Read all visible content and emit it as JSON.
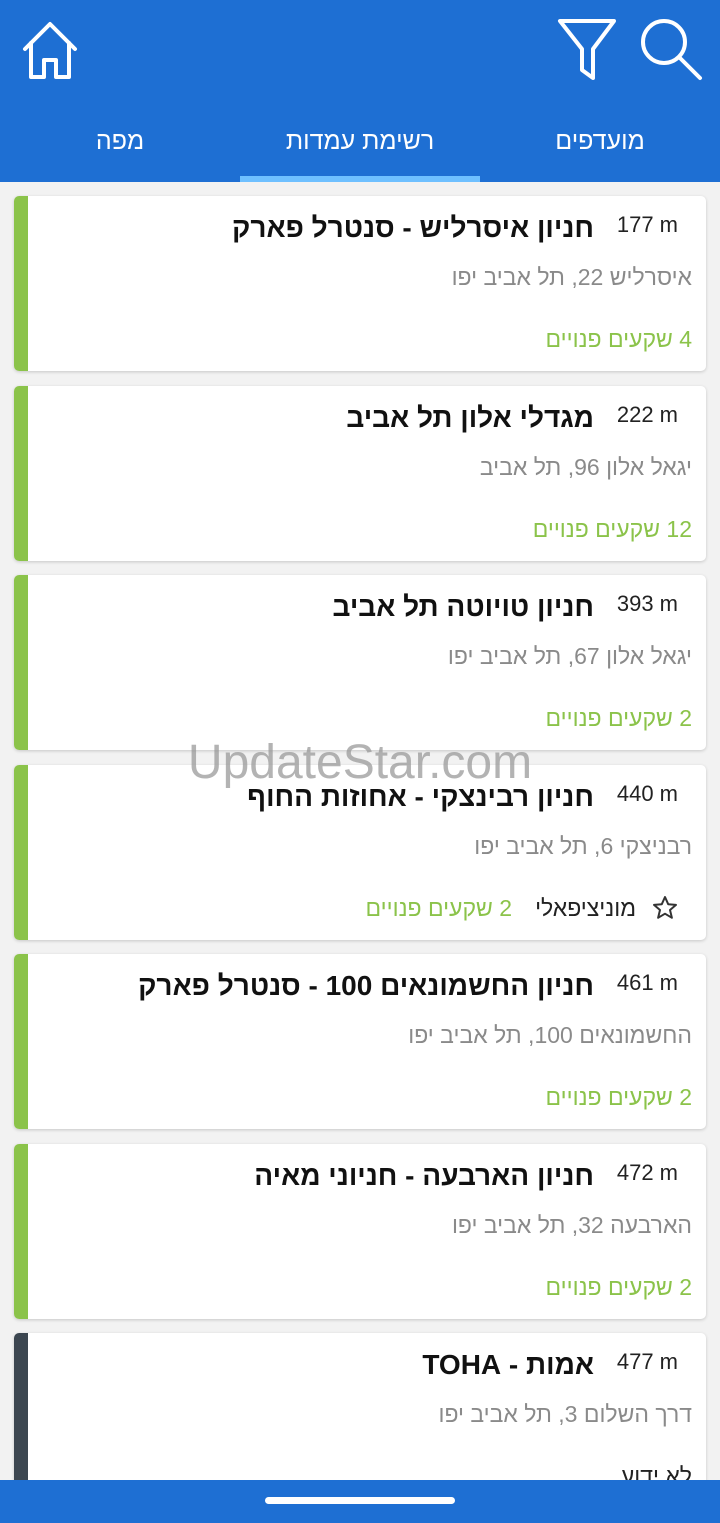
{
  "header": {
    "background": "#1e6fd3",
    "icons": {
      "home": "home-icon",
      "filter": "filter-icon",
      "search": "search-icon"
    },
    "tabs": [
      {
        "label": "מפה",
        "selected": false
      },
      {
        "label": "רשימת עמדות",
        "selected": true
      },
      {
        "label": "מועדפים",
        "selected": false
      }
    ]
  },
  "colors": {
    "available": "#8bc34a",
    "unknown": "#3c4650",
    "indicator": "#6fc0ff"
  },
  "parkings": [
    {
      "distance": "177 m",
      "name": "חניון איסרליש - סנטרל פארק",
      "address": "איסרליש 22, תל אביב יפו",
      "spots": "4 שקעים פנויים",
      "status_color": "#8bc34a"
    },
    {
      "distance": "222 m",
      "name": "מגדלי אלון תל אביב",
      "address": "יגאל אלון 96, תל אביב",
      "spots": "12 שקעים פנויים",
      "status_color": "#8bc34a"
    },
    {
      "distance": "393 m",
      "name": "חניון טויוטה תל אביב",
      "address": "יגאל אלון 67, תל אביב יפו",
      "spots": "2 שקעים פנויים",
      "status_color": "#8bc34a"
    },
    {
      "distance": "440 m",
      "name": "חניון רבינצקי - אחוזות החוף",
      "address": "רבניצקי 6, תל אביב יפו",
      "spots": "2 שקעים פנויים",
      "operator": "מוניציפאלי",
      "favorite_icon": "star-outline-icon",
      "status_color": "#8bc34a"
    },
    {
      "distance": "461 m",
      "name": "חניון החשמונאים 100 - סנטרל פארק",
      "address": "החשמונאים 100, תל אביב יפו",
      "spots": "2 שקעים פנויים",
      "status_color": "#8bc34a"
    },
    {
      "distance": "472 m",
      "name": "חניון הארבעה - חניוני מאיה",
      "address": "הארבעה 32, תל אביב יפו",
      "spots": "2 שקעים פנויים",
      "status_color": "#8bc34a"
    },
    {
      "distance": "477 m",
      "name": "אמות - TOHA",
      "address": "דרך השלום 3, תל אביב יפו",
      "spots": "לא ידוע",
      "status_color": "#3c4650"
    }
  ],
  "watermark": "UpdateStar.com"
}
